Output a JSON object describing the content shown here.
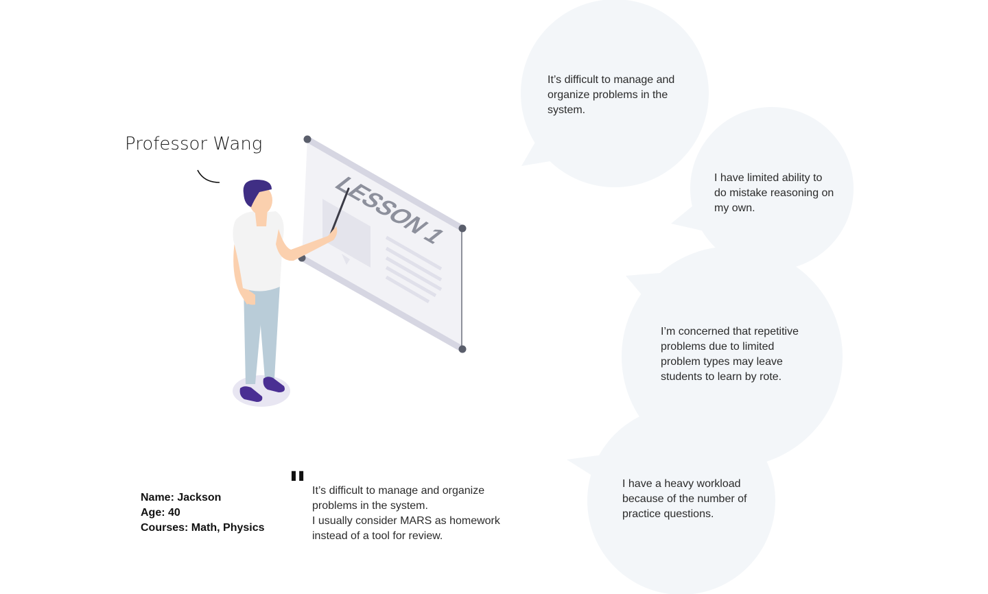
{
  "persona": {
    "title": "Professor Wang",
    "details": [
      "Name: Jackson",
      "Age: 40",
      "Courses: Math, Physics"
    ]
  },
  "quote": {
    "mark": "\"",
    "lines": [
      "It’s difficult to manage and organize",
      "problems in the system.",
      "I usually consider MARS as homework",
      "instead of a tool for review."
    ]
  },
  "board": {
    "heading": "LESSON 1"
  },
  "bubbles": [
    {
      "lines": [
        "It’s difficult to manage and",
        "organize problems in the",
        "system."
      ]
    },
    {
      "lines": [
        "I have limited ability to",
        "do mistake reasoning on",
        "my own."
      ]
    },
    {
      "lines": [
        "I’m concerned that repetitive",
        "problems due to limited",
        "problem types may leave",
        "students to learn by rote."
      ]
    },
    {
      "lines": [
        "I have a heavy workload",
        "because of the number of",
        "practice questions."
      ]
    }
  ],
  "colors": {
    "bubble_fill": "#f3f6f9",
    "board_fill": "#f1f1f6",
    "board_frame": "#d6d6e2",
    "hair": "#3f2e84",
    "shoes": "#4a2f93",
    "skin": "#fbd0ae",
    "pants": "#b9ccd8",
    "shirt": "#f3f3f3"
  }
}
